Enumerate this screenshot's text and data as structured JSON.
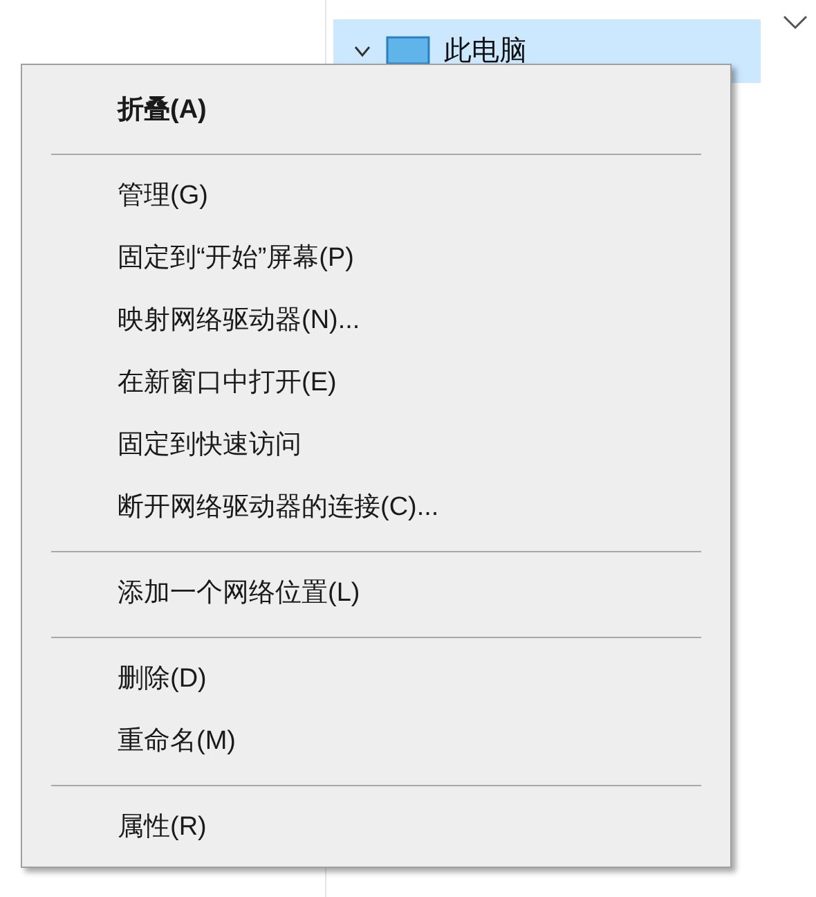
{
  "tree": {
    "items": [
      {
        "label": "此电脑",
        "selected": true,
        "expanded": true
      }
    ]
  },
  "context_menu": {
    "groups": [
      [
        {
          "label": "折叠(A)",
          "kind": "default"
        }
      ],
      [
        {
          "label": "管理(G)",
          "kind": "normal"
        },
        {
          "label": "固定到“开始”屏幕(P)",
          "kind": "normal"
        },
        {
          "label": "映射网络驱动器(N)...",
          "kind": "normal"
        },
        {
          "label": "在新窗口中打开(E)",
          "kind": "normal"
        },
        {
          "label": "固定到快速访问",
          "kind": "normal"
        },
        {
          "label": "断开网络驱动器的连接(C)...",
          "kind": "normal"
        }
      ],
      [
        {
          "label": "添加一个网络位置(L)",
          "kind": "normal"
        }
      ],
      [
        {
          "label": "删除(D)",
          "kind": "normal"
        },
        {
          "label": "重命名(M)",
          "kind": "normal"
        }
      ],
      [
        {
          "label": "属性(R)",
          "kind": "normal"
        }
      ]
    ]
  }
}
